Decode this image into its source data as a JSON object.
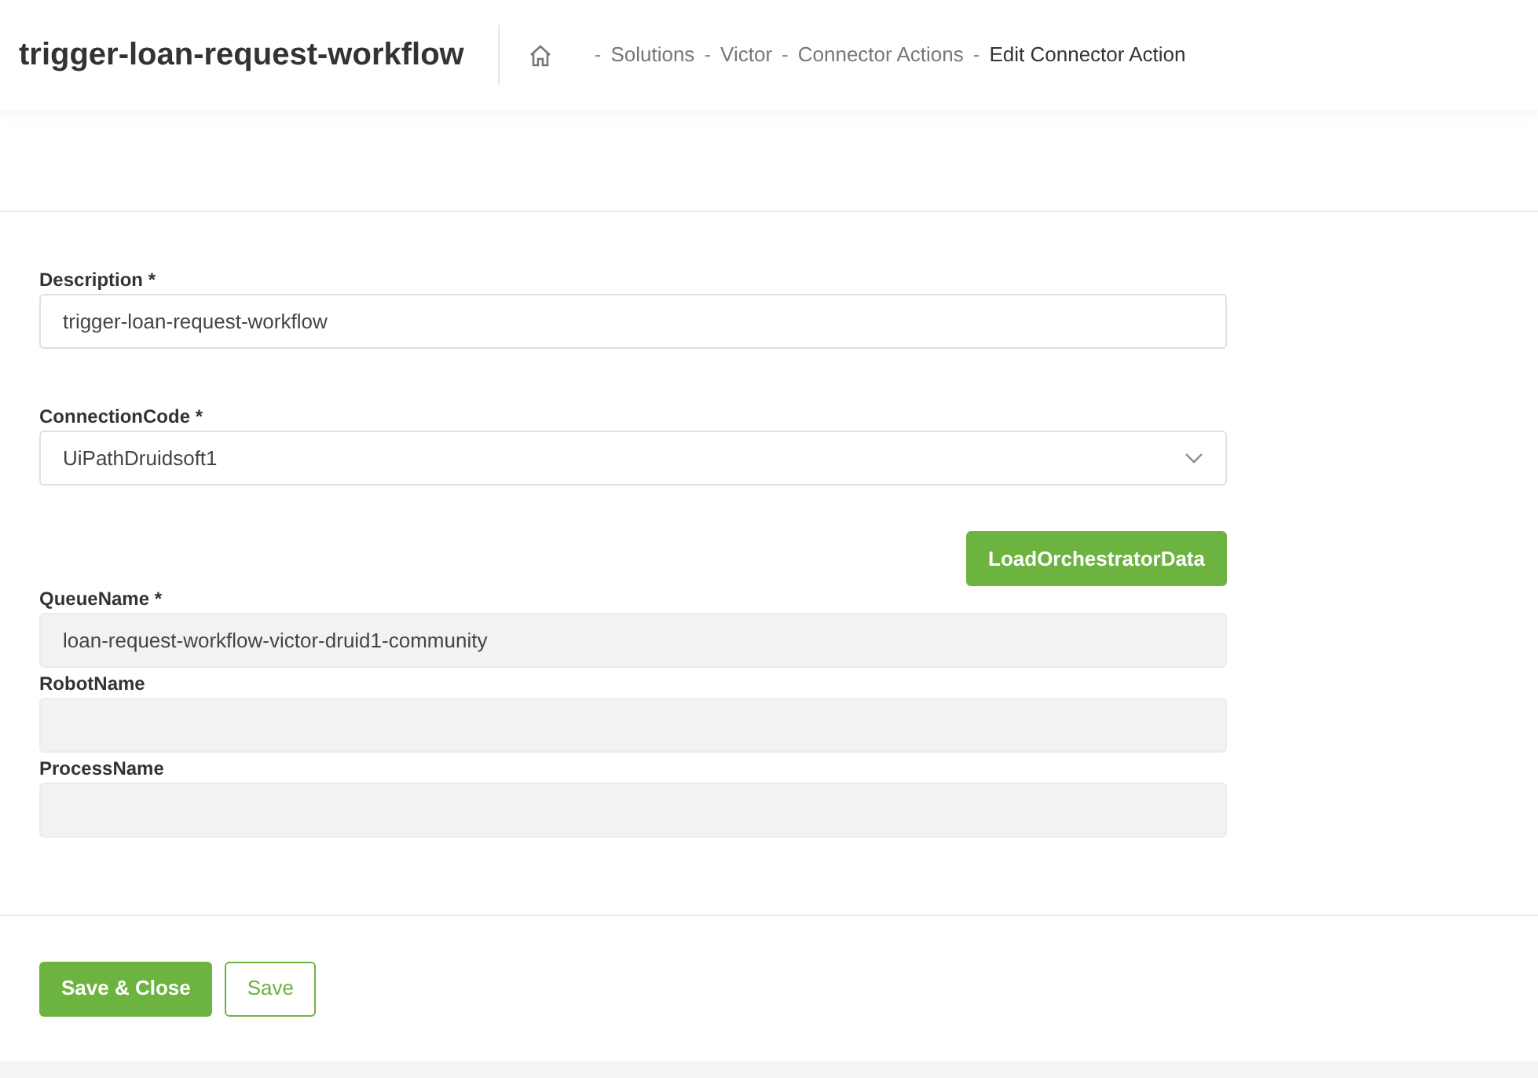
{
  "page_title": "trigger-loan-request-workflow",
  "breadcrumb_separator": "-",
  "breadcrumbs": [
    {
      "label": "Solutions",
      "current": false
    },
    {
      "label": "Victor",
      "current": false
    },
    {
      "label": "Connector Actions",
      "current": false
    },
    {
      "label": "Edit Connector Action",
      "current": true
    }
  ],
  "fields": [
    {
      "kind": "text",
      "label": "Description *",
      "value": "trigger-loan-request-workflow",
      "disabled": false
    },
    {
      "kind": "select",
      "label": "ConnectionCode *",
      "value": "UiPathDruidsoft1",
      "disabled": false
    },
    {
      "kind": "button",
      "label": "LoadOrchestratorData"
    },
    {
      "kind": "text",
      "label": "QueueName *",
      "value": "loan-request-workflow-victor-druid1-community",
      "disabled": true
    },
    {
      "kind": "text",
      "label": "RobotName",
      "disabled": true
    },
    {
      "kind": "text",
      "label": "ProcessName",
      "disabled": true
    }
  ],
  "footer_buttons": [
    {
      "label": "Save & Close",
      "primary": true
    },
    {
      "label": "Save",
      "primary": false
    }
  ]
}
